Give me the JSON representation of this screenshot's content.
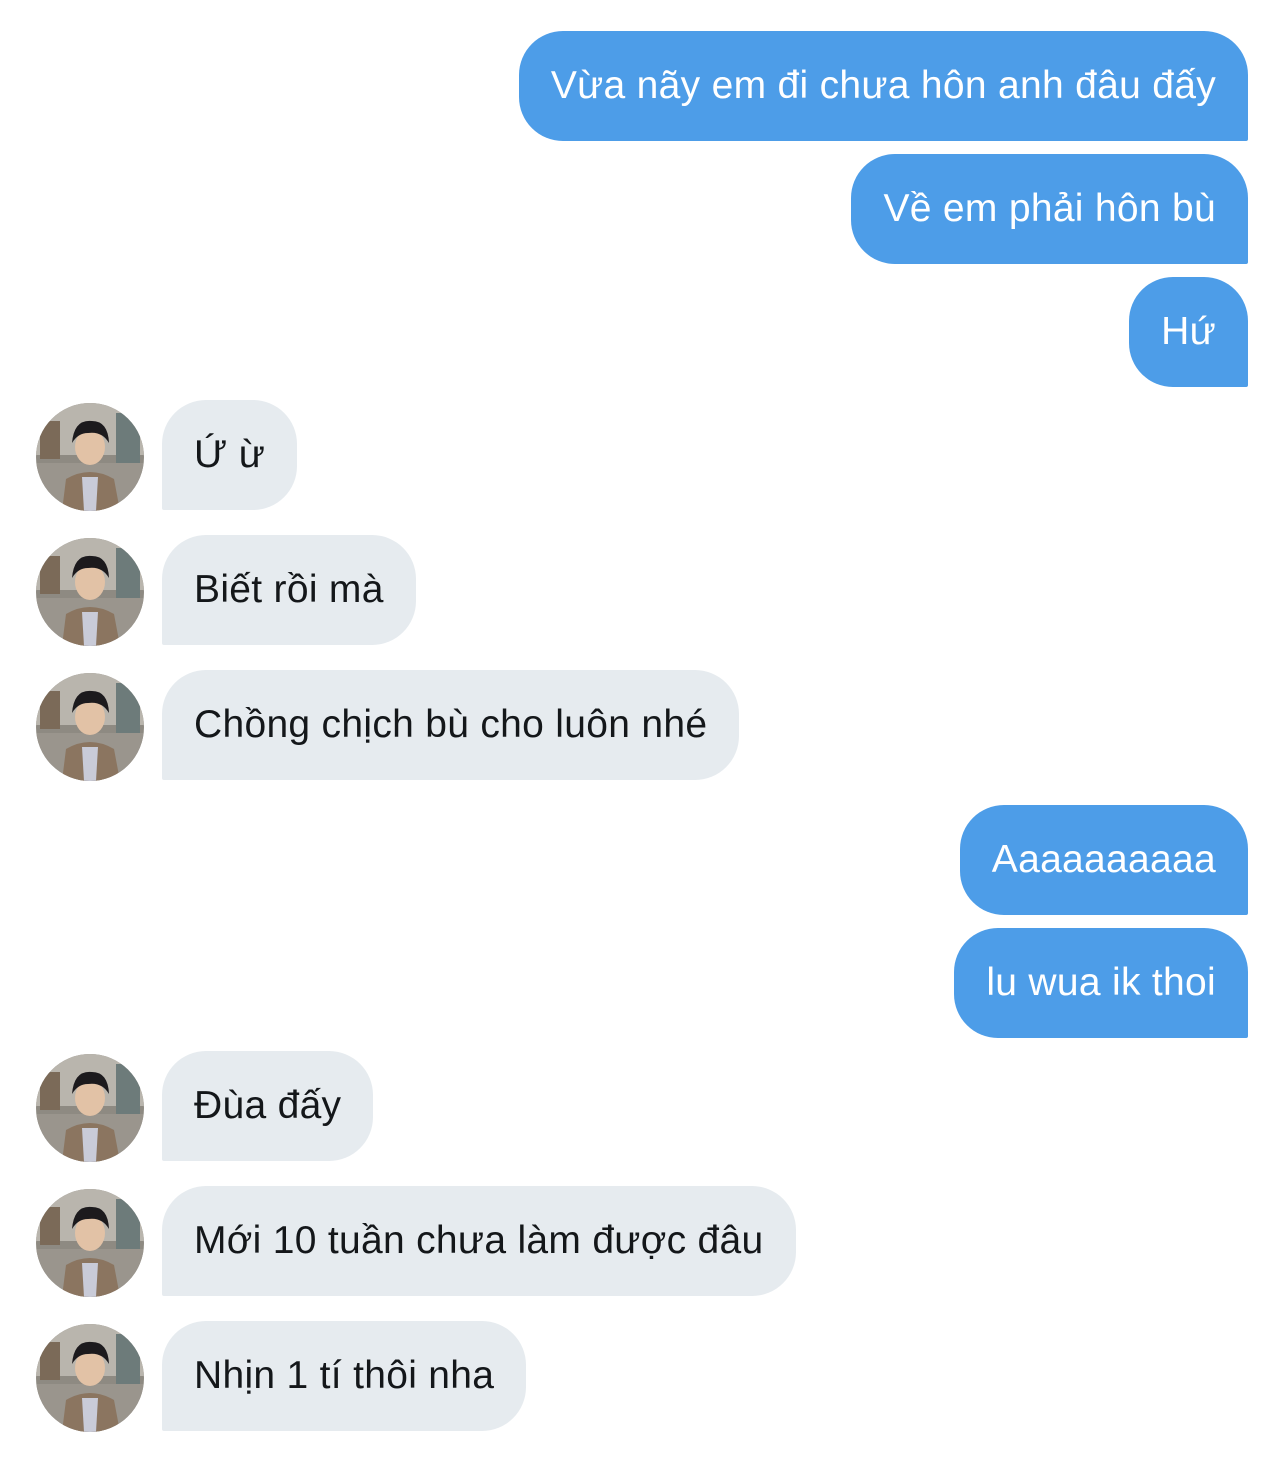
{
  "conversation": {
    "messages": [
      {
        "side": "sent",
        "text": "Vừa nãy em đi chưa hôn anh đâu đấy"
      },
      {
        "side": "sent",
        "text": "Về em phải hôn bù"
      },
      {
        "side": "sent",
        "text": "Hứ"
      },
      {
        "side": "received",
        "text": "Ứ ừ"
      },
      {
        "side": "received",
        "text": "Biết rồi mà"
      },
      {
        "side": "received",
        "text": "Chồng chịch bù cho luôn nhé"
      },
      {
        "side": "sent",
        "text": "Aaaaaaaaaa"
      },
      {
        "side": "sent",
        "text": "lu wua ik thoi"
      },
      {
        "side": "received",
        "text": "Đùa đấy"
      },
      {
        "side": "received",
        "text": "Mới 10 tuần chưa làm được đâu"
      },
      {
        "side": "received",
        "text": "Nhịn 1 tí thôi nha"
      }
    ]
  },
  "colors": {
    "sent_bubble": "#4d9de8",
    "sent_text": "#ffffff",
    "received_bubble": "#e6ebef",
    "received_text": "#14171a",
    "background": "#ffffff"
  },
  "icons": {
    "avatar": "contact-avatar-photo"
  }
}
